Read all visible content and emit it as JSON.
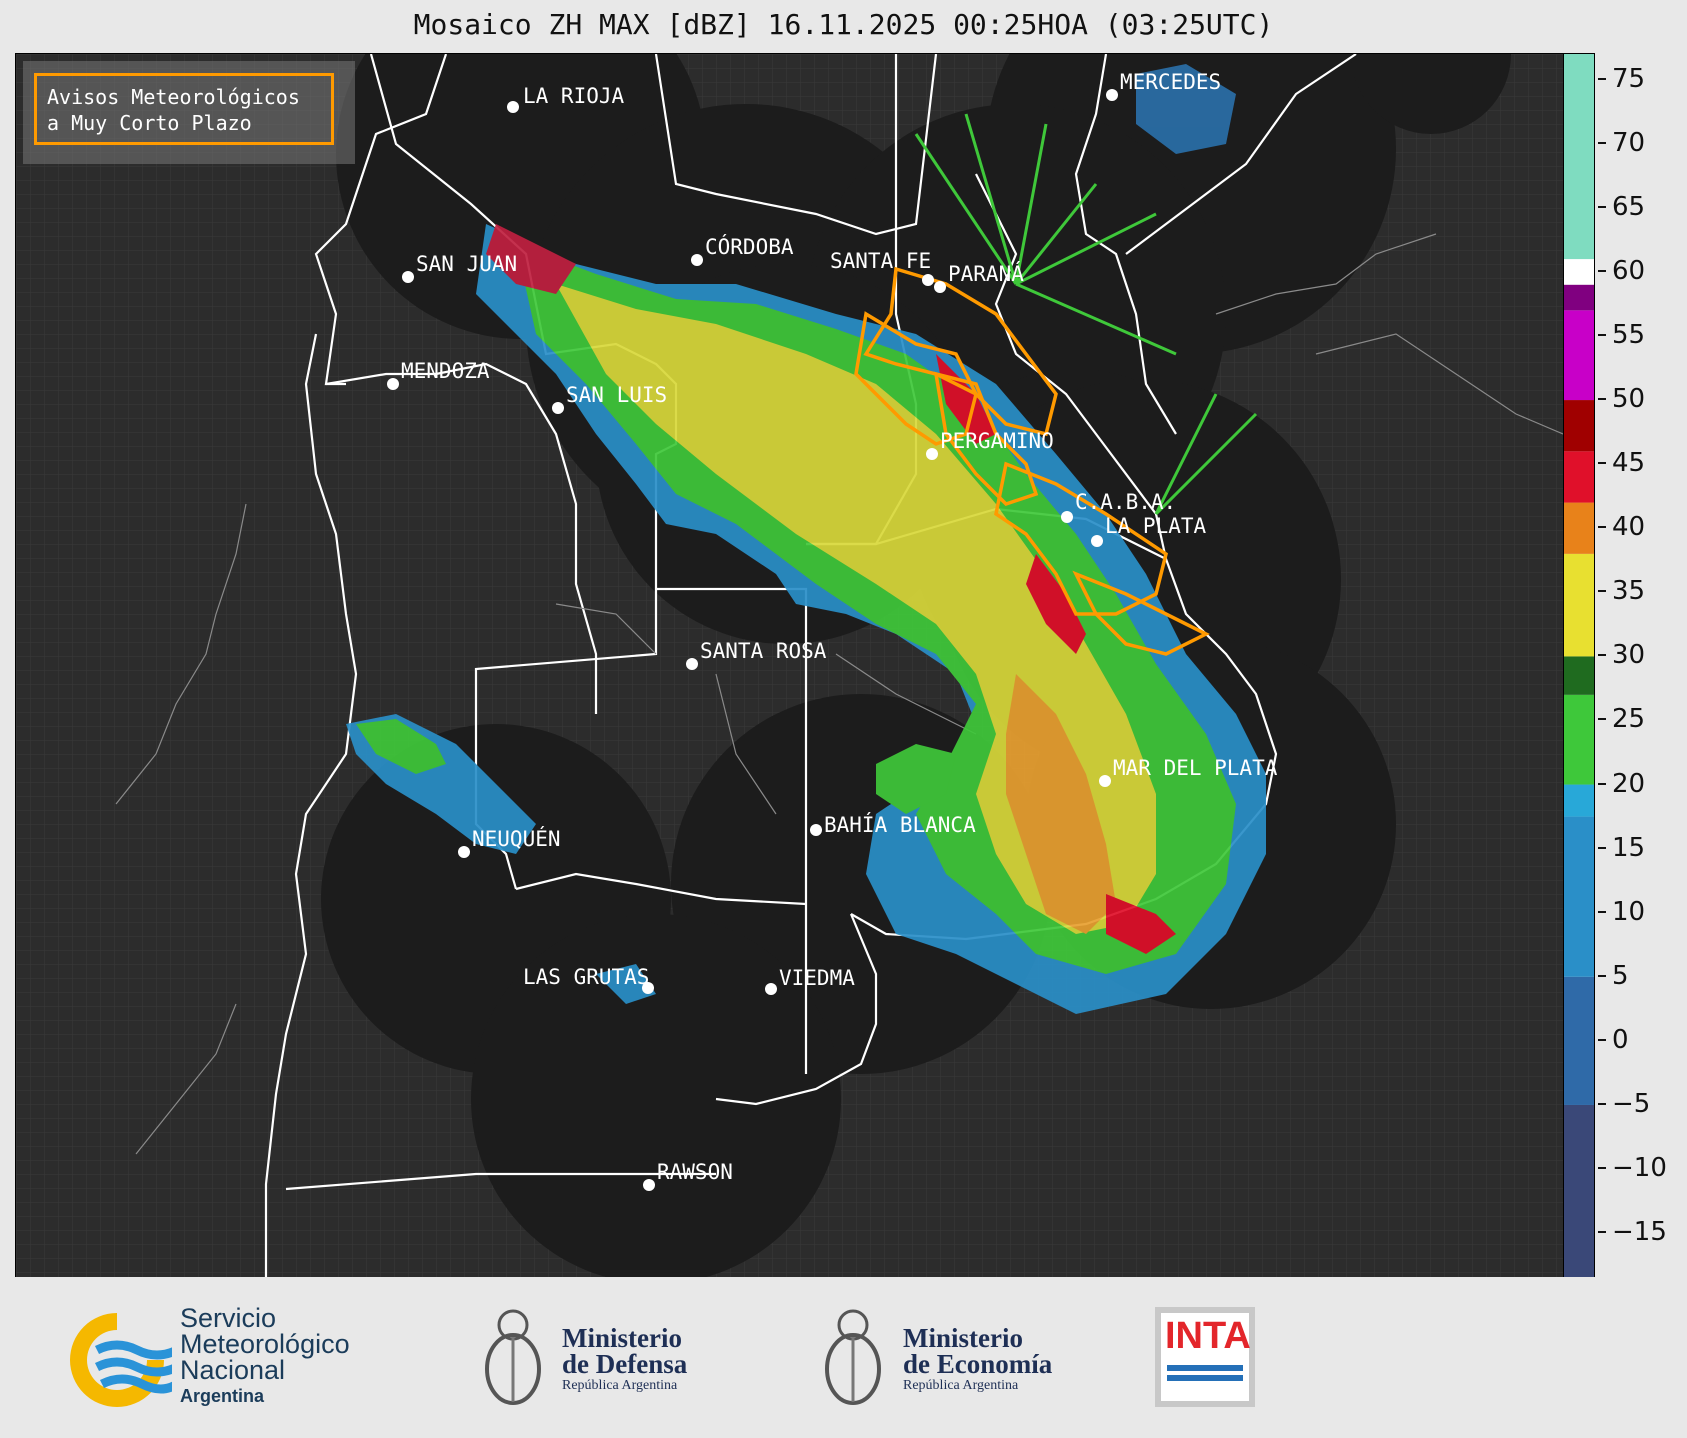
{
  "title": "Mosaico ZH MAX [dBZ] 16.11.2025 00:25HOA (03:25UTC)",
  "legend_box": {
    "line1": "Avisos Meteorológicos",
    "line2": "a Muy Corto Plazo",
    "border_color": "#ff9a00"
  },
  "cities": [
    {
      "name": "LA RIOJA"
    },
    {
      "name": "MERCEDES"
    },
    {
      "name": "CÓRDOBA"
    },
    {
      "name": "SAN JUAN"
    },
    {
      "name": "SANTA FE"
    },
    {
      "name": "PARANÁ"
    },
    {
      "name": "MENDOZA"
    },
    {
      "name": "SAN LUIS"
    },
    {
      "name": "PERGAMINO"
    },
    {
      "name": "C.A.B.A."
    },
    {
      "name": "LA PLATA"
    },
    {
      "name": "SANTA ROSA"
    },
    {
      "name": "MAR DEL PLATA"
    },
    {
      "name": "BAHÍA BLANCA"
    },
    {
      "name": "NEUQUÉN"
    },
    {
      "name": "LAS GRUTAS"
    },
    {
      "name": "VIEDMA"
    },
    {
      "name": "RAWSON"
    }
  ],
  "colorbar": {
    "unit": "dBZ",
    "ticks": [
      "75",
      "70",
      "65",
      "60",
      "55",
      "50",
      "45",
      "40",
      "35",
      "30",
      "25",
      "20",
      "15",
      "10",
      "5",
      "0",
      "−5",
      "−10",
      "−15"
    ],
    "colors": {
      "light": "#ffffff",
      "cyan_green": "#7fdcc0",
      "magenta": "#c800c8",
      "darkred": "#a00000",
      "red": "#e0102a",
      "orange": "#e8821a",
      "yellow": "#e8e030",
      "darkgreen": "#1f6b1f",
      "green": "#3ec83a",
      "cyan": "#28a8d8",
      "blue": "#2f6aa8",
      "navy": "#3a4878"
    }
  },
  "footer": {
    "smn": {
      "line1": "Servicio",
      "line2": "Meteorológico",
      "line3": "Nacional",
      "line4": "Argentina"
    },
    "defensa": {
      "line1": "Ministerio",
      "line2": "de Defensa",
      "line3": "República Argentina"
    },
    "economia": {
      "line1": "Ministerio",
      "line2": "de Economía",
      "line3": "República Argentina"
    },
    "inta": {
      "label": "INTA"
    }
  }
}
